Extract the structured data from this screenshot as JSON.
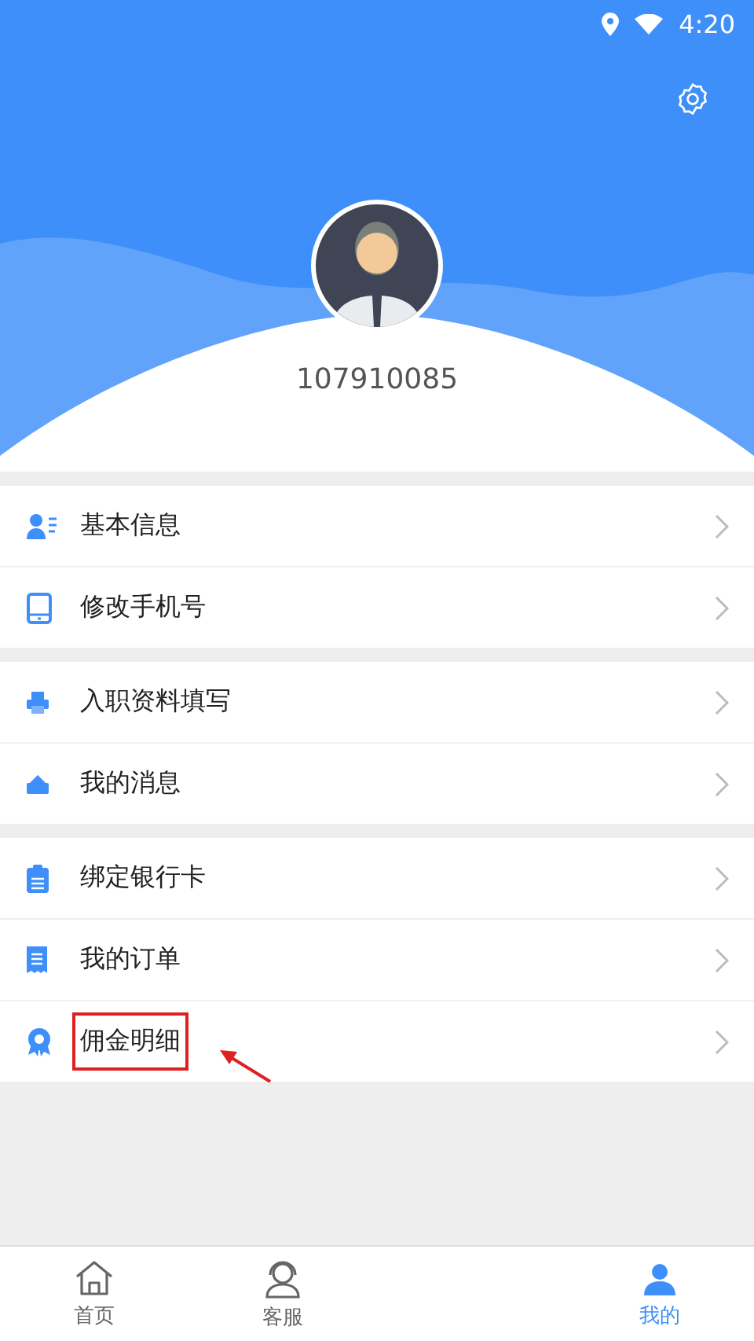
{
  "status_bar": {
    "time": "4:20"
  },
  "profile": {
    "user_id": "107910085"
  },
  "menu_groups": [
    {
      "items": [
        {
          "label": "基本信息",
          "kind": "person",
          "highlighted": false
        },
        {
          "label": "修改手机号",
          "kind": "phone",
          "highlighted": false
        }
      ]
    },
    {
      "items": [
        {
          "label": "入职资料填写",
          "kind": "printer",
          "highlighted": false
        },
        {
          "label": "我的消息",
          "kind": "message",
          "highlighted": false
        }
      ]
    },
    {
      "items": [
        {
          "label": "绑定银行卡",
          "kind": "clipboard",
          "highlighted": false
        },
        {
          "label": "我的订单",
          "kind": "receipt",
          "highlighted": false
        },
        {
          "label": "佣金明细",
          "kind": "award",
          "highlighted": true
        }
      ]
    }
  ],
  "tab_bar": [
    {
      "label": "首页",
      "kind": "home",
      "selected": false
    },
    {
      "label": "客服",
      "kind": "headset",
      "selected": false
    },
    {
      "label": "我的",
      "kind": "user",
      "selected": true
    }
  ]
}
